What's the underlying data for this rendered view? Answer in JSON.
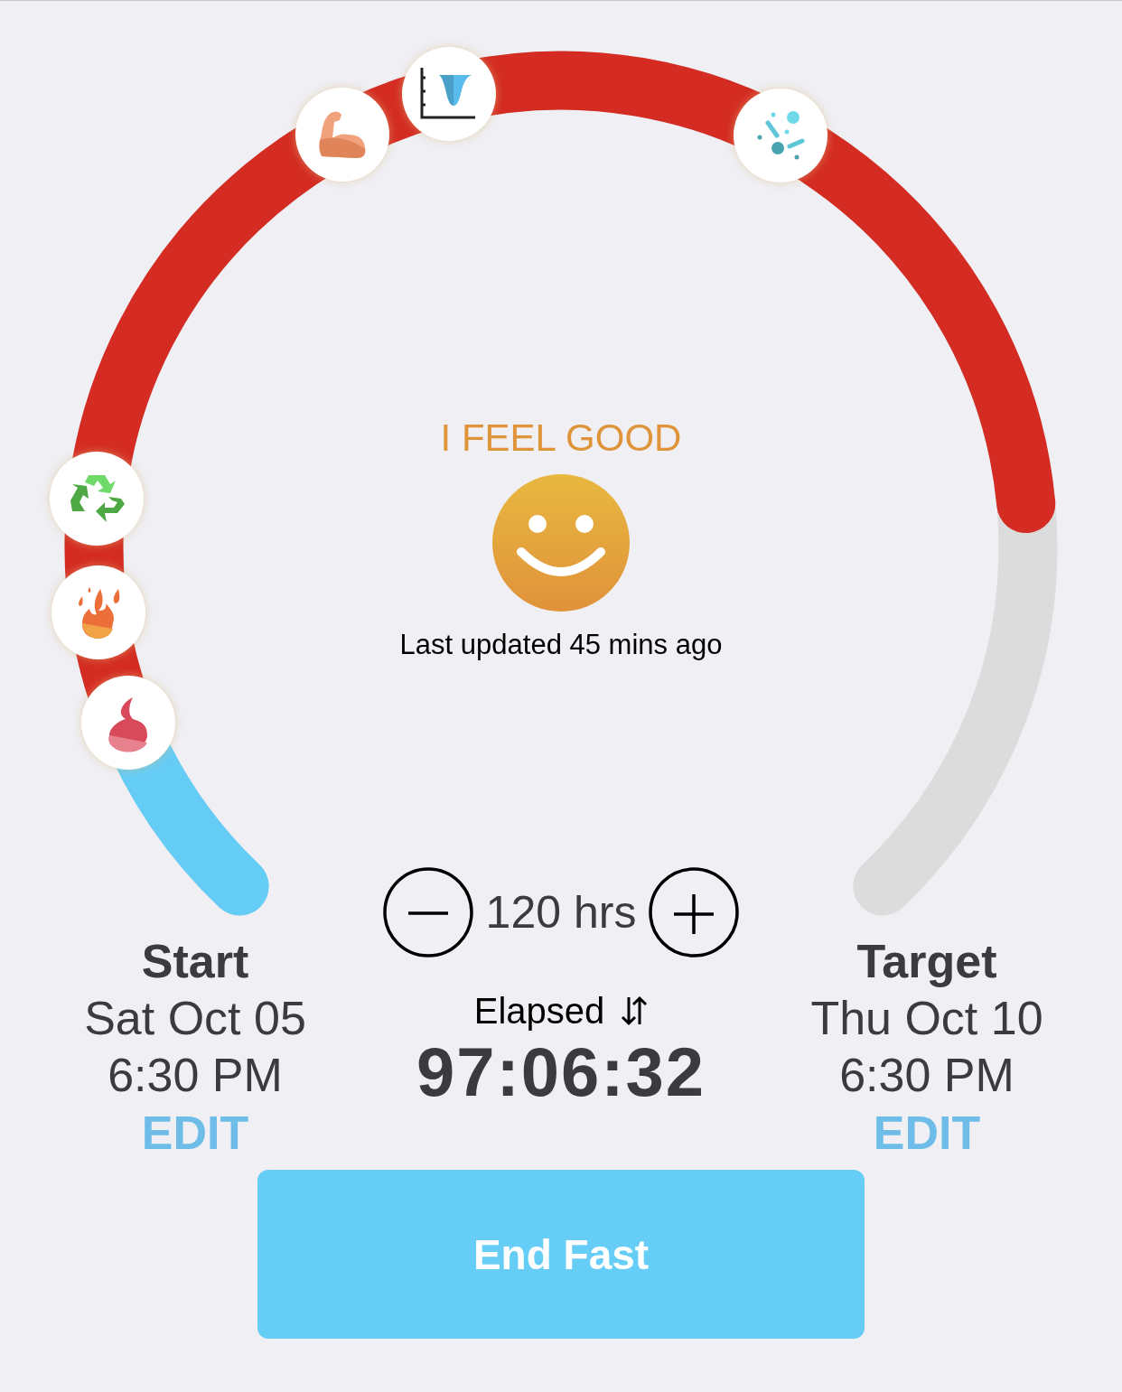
{
  "milestones": [
    {
      "kind": "drop"
    },
    {
      "kind": "flame"
    },
    {
      "kind": "recycle"
    },
    {
      "kind": "muscle"
    },
    {
      "kind": "curve"
    },
    {
      "kind": "bacteria"
    }
  ],
  "mood": {
    "label": "I FEEL GOOD",
    "updated": "Last updated 45 mins ago"
  },
  "goal": {
    "hours": "120 hrs"
  },
  "start": {
    "title": "Start",
    "date": "Sat Oct 05",
    "time": "6:30 PM",
    "action": "EDIT"
  },
  "timer": {
    "label": "Elapsed",
    "value": "97:06:32"
  },
  "target": {
    "title": "Target",
    "date": "Thu Oct 10",
    "time": "6:30 PM",
    "action": "EDIT"
  },
  "button": {
    "label": "End Fast"
  }
}
